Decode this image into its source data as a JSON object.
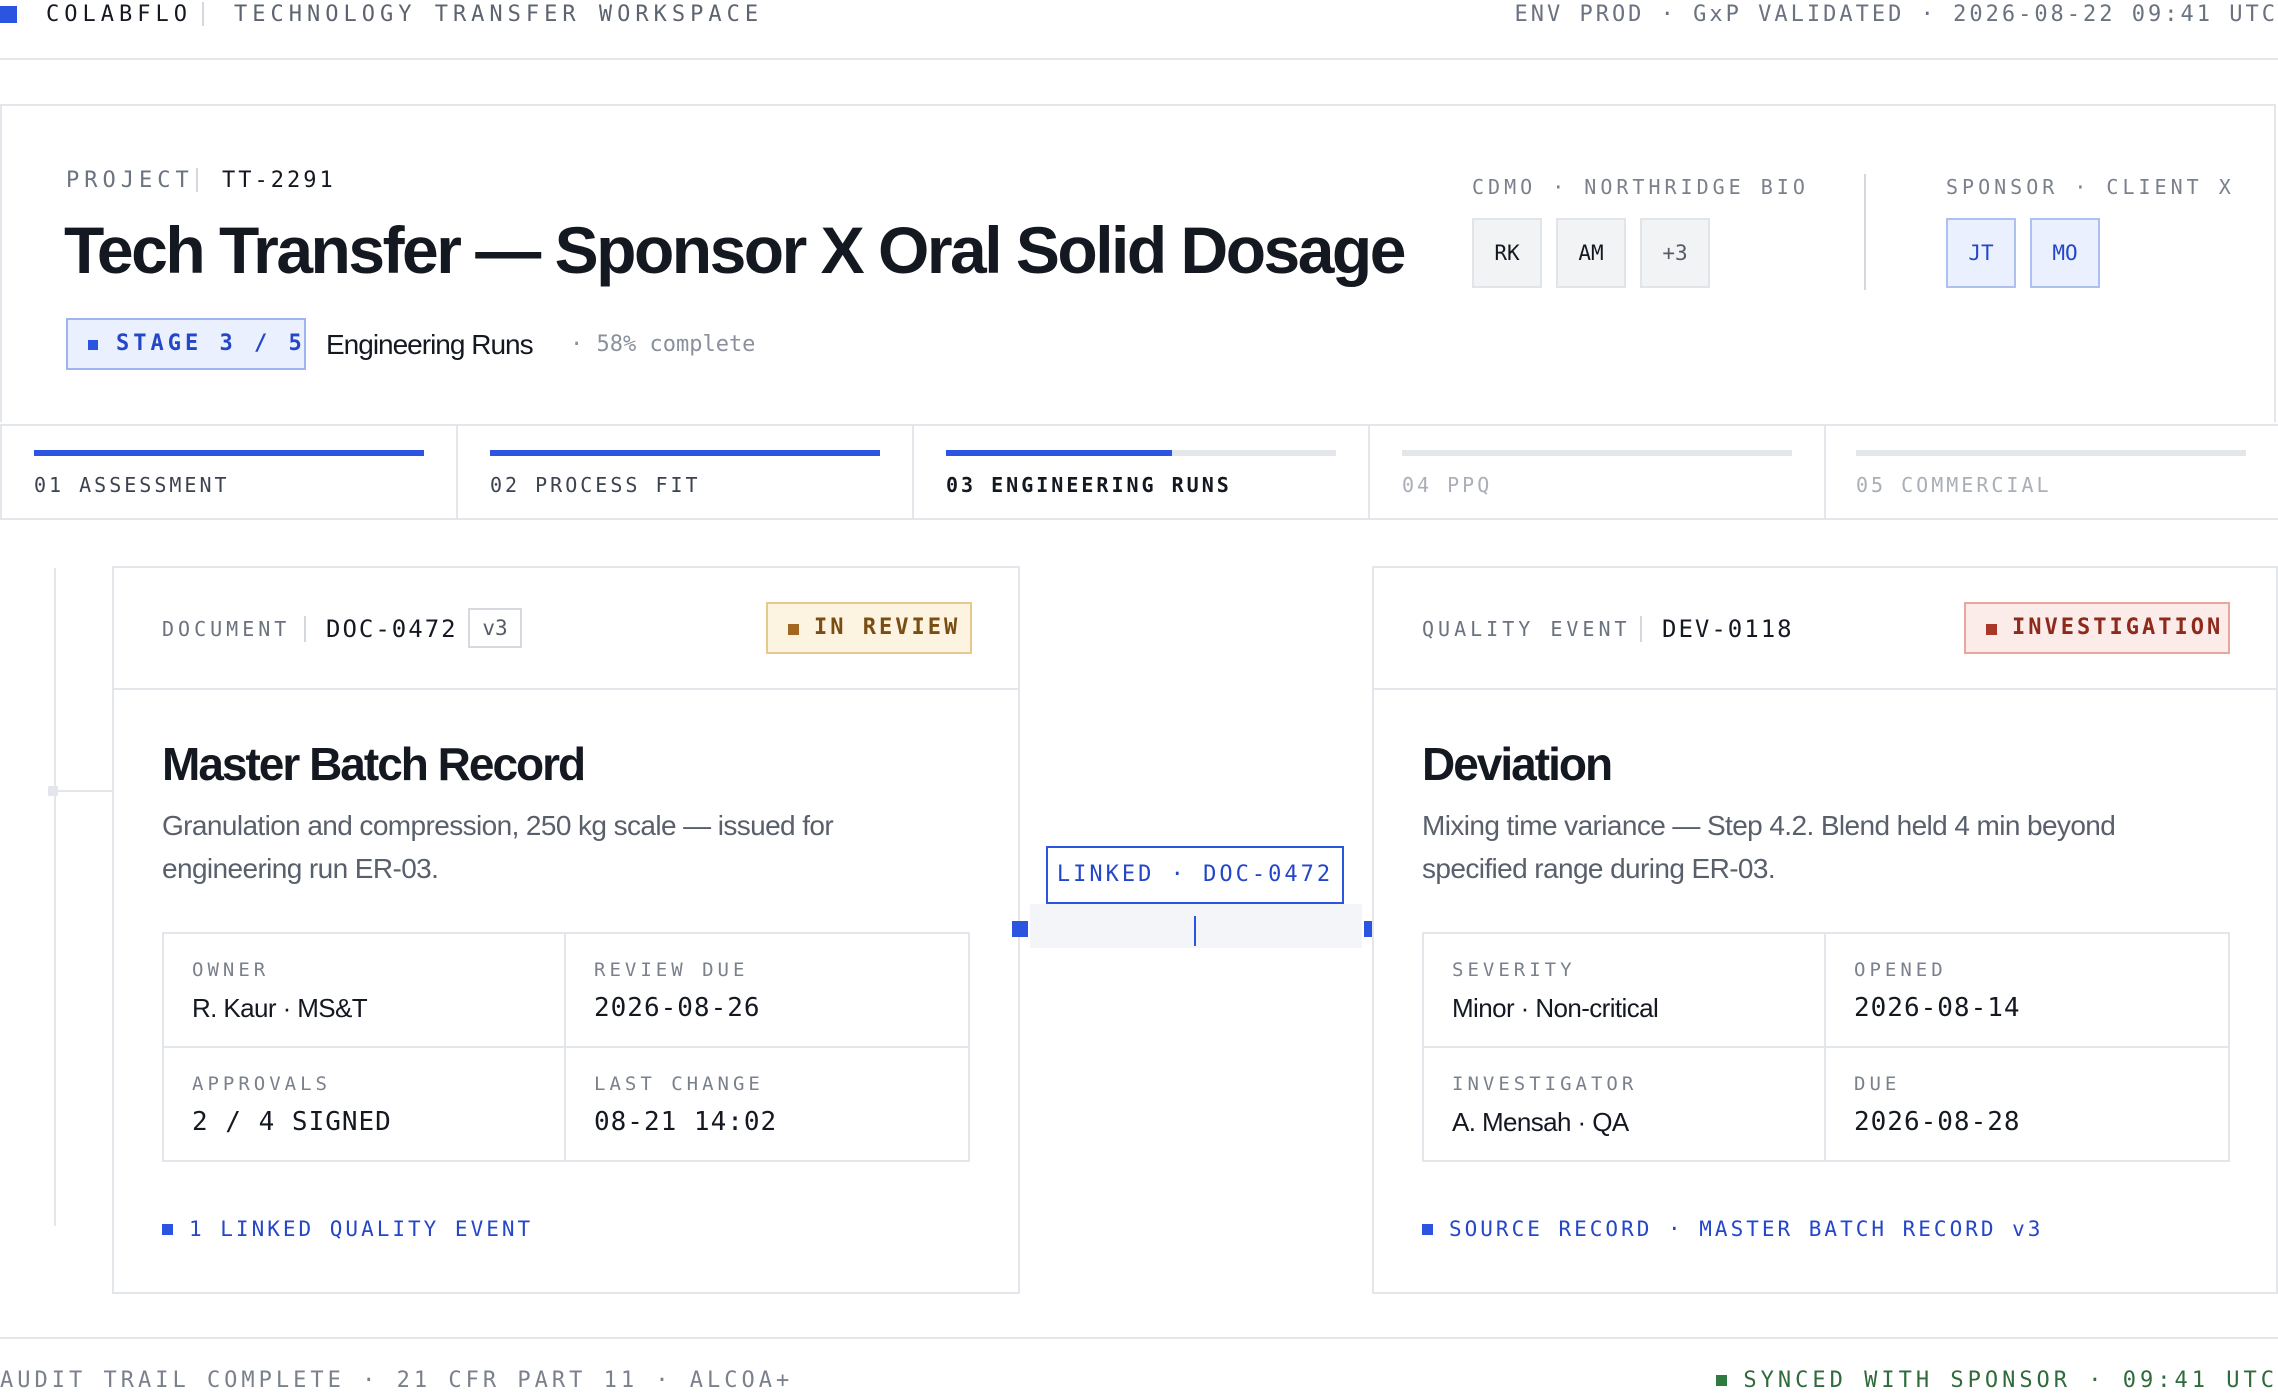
{
  "topbar": {
    "brand": "COLABFLO",
    "workspace": "TECHNOLOGY TRANSFER WORKSPACE",
    "env": "ENV PROD · GxP VALIDATED · 2026-08-22 09:41 UTC"
  },
  "project": {
    "label": "PROJECT",
    "id": "TT-2291",
    "title": "Tech Transfer — Sponsor X Oral Solid Dosage",
    "stage_badge": "STAGE 3 / 5",
    "stage_name": "Engineering Runs",
    "completion": "· 58% complete",
    "progress_percent": 58
  },
  "teams": {
    "cdmo": {
      "label": "CDMO · NORTHRIDGE BIO",
      "members": [
        "RK",
        "AM",
        "+3"
      ]
    },
    "sponsor": {
      "label": "SPONSOR · CLIENT X",
      "members": [
        "JT",
        "MO"
      ]
    }
  },
  "stages": [
    {
      "label": "01 ASSESSMENT",
      "progress": 1.0,
      "state": "done"
    },
    {
      "label": "02 PROCESS FIT",
      "progress": 1.0,
      "state": "done"
    },
    {
      "label": "03 ENGINEERING RUNS",
      "progress": 0.58,
      "state": "active"
    },
    {
      "label": "04 PPQ",
      "progress": 0,
      "state": "pending"
    },
    {
      "label": "05 COMMERCIAL",
      "progress": 0,
      "state": "pending"
    }
  ],
  "document": {
    "type_label": "DOCUMENT",
    "id": "DOC-0472",
    "version": "v3",
    "status": "IN REVIEW",
    "title": "Master Batch Record",
    "description": "Granulation and compression, 250 kg scale — issued for engineering run ER-03.",
    "fields": {
      "owner_label": "OWNER",
      "owner": "R. Kaur · MS&T",
      "review_due_label": "REVIEW DUE",
      "review_due": "2026-08-26",
      "approvals_label": "APPROVALS",
      "approvals": "2 / 4 SIGNED",
      "last_change_label": "LAST CHANGE",
      "last_change": "08-21 14:02"
    },
    "link_text": "1 LINKED QUALITY EVENT"
  },
  "connector": {
    "label": "LINKED · DOC-0472"
  },
  "quality_event": {
    "type_label": "QUALITY EVENT",
    "id": "DEV-0118",
    "status": "INVESTIGATION",
    "title": "Deviation",
    "description": "Mixing time variance — Step 4.2. Blend held 4 min beyond specified range during ER-03.",
    "fields": {
      "severity_label": "SEVERITY",
      "severity": "Minor · Non-critical",
      "opened_label": "OPENED",
      "opened": "2026-08-14",
      "investigator_label": "INVESTIGATOR",
      "investigator": "A. Mensah · QA",
      "due_label": "DUE",
      "due": "2026-08-28"
    },
    "link_text": "SOURCE RECORD · MASTER BATCH RECORD v3"
  },
  "footer": {
    "audit": "AUDIT TRAIL COMPLETE · 21 CFR PART 11 · ALCOA+",
    "sync": "SYNCED WITH SPONSOR · 09:41 UTC"
  },
  "colors": {
    "accent": "#2b55e0",
    "review_bg": "#fdf3e1",
    "review_border": "#e7c98f",
    "review_text": "#7a4e12",
    "investigation_bg": "#fbece9",
    "investigation_border": "#e7a79c",
    "investigation_text": "#8e2a1c",
    "synced": "#2f7a3e"
  }
}
